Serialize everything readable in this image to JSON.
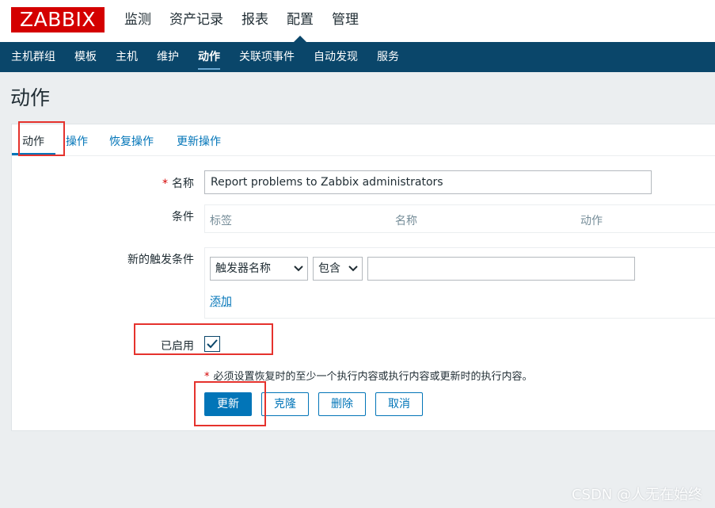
{
  "logo": "ZABBIX",
  "main_menu": [
    "监测",
    "资产记录",
    "报表",
    "配置",
    "管理"
  ],
  "sub_menu": [
    "主机群组",
    "模板",
    "主机",
    "维护",
    "动作",
    "关联项事件",
    "自动发现",
    "服务"
  ],
  "page_title": "动作",
  "tabs": [
    "动作",
    "操作",
    "恢复操作",
    "更新操作"
  ],
  "form": {
    "name_label": "名称",
    "name_value": "Report problems to Zabbix administrators",
    "conditions_label": "条件",
    "conditions_headers": [
      "标签",
      "名称",
      "动作"
    ],
    "new_condition_label": "新的触发条件",
    "condition_type": "触发器名称",
    "condition_operator": "包含",
    "condition_value": "",
    "add_link": "添加",
    "enabled_label": "已启用",
    "enabled": true,
    "note": "必须设置恢复时的至少一个执行内容或执行内容或更新时的执行内容。"
  },
  "buttons": {
    "update": "更新",
    "clone": "克隆",
    "delete": "删除",
    "cancel": "取消"
  },
  "watermark": "CSDN @人无在始终",
  "colors": {
    "brand": "#d40000",
    "nav": "#0a466a",
    "link": "#0275b8",
    "highlight": "#e5322d"
  }
}
